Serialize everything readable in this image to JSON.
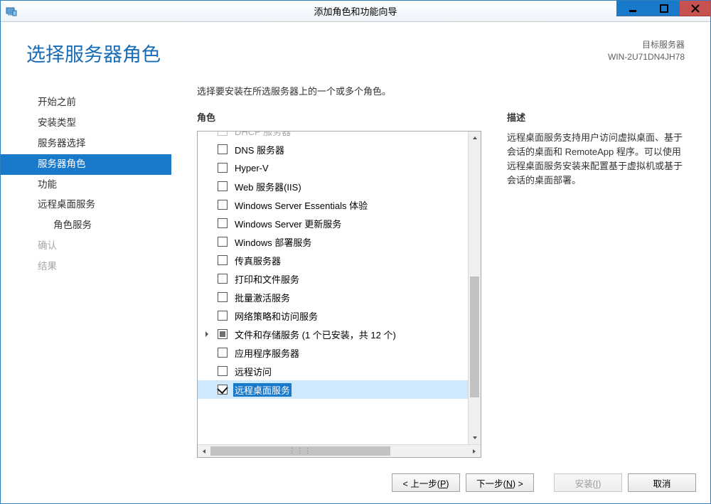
{
  "window_title": "添加角色和功能向导",
  "page_title": "选择服务器角色",
  "target": {
    "label": "目标服务器",
    "name": "WIN-2U71DN4JH78"
  },
  "sidebar": {
    "items": [
      {
        "label": "开始之前"
      },
      {
        "label": "安装类型"
      },
      {
        "label": "服务器选择"
      },
      {
        "label": "服务器角色"
      },
      {
        "label": "功能"
      },
      {
        "label": "远程桌面服务"
      },
      {
        "label": "角色服务"
      },
      {
        "label": "确认"
      },
      {
        "label": "结果"
      }
    ]
  },
  "instruction": "选择要安装在所选服务器上的一个或多个角色。",
  "roles_label": "角色",
  "desc_label": "描述",
  "description": "远程桌面服务支持用户访问虚拟桌面、基于会话的桌面和 RemoteApp 程序。可以使用远程桌面服务安装来配置基于虚拟机或基于会话的桌面部署。",
  "roles": [
    {
      "label": "DHCP 服务器",
      "checked": false
    },
    {
      "label": "DNS 服务器",
      "checked": false
    },
    {
      "label": "Hyper-V",
      "checked": false
    },
    {
      "label": "Web 服务器(IIS)",
      "checked": false
    },
    {
      "label": "Windows Server Essentials 体验",
      "checked": false
    },
    {
      "label": "Windows Server 更新服务",
      "checked": false
    },
    {
      "label": "Windows 部署服务",
      "checked": false
    },
    {
      "label": "传真服务器",
      "checked": false
    },
    {
      "label": "打印和文件服务",
      "checked": false
    },
    {
      "label": "批量激活服务",
      "checked": false
    },
    {
      "label": "网络策略和访问服务",
      "checked": false
    },
    {
      "label": "文件和存储服务 (1 个已安装，共 12 个)",
      "checked": "partial",
      "expandable": true
    },
    {
      "label": "应用程序服务器",
      "checked": false
    },
    {
      "label": "远程访问",
      "checked": false
    },
    {
      "label": "远程桌面服务",
      "checked": true,
      "selected": true
    }
  ],
  "buttons": {
    "prev": "< 上一步(P)",
    "next": "下一步(N) >",
    "install": "安装(I)",
    "cancel": "取消"
  }
}
